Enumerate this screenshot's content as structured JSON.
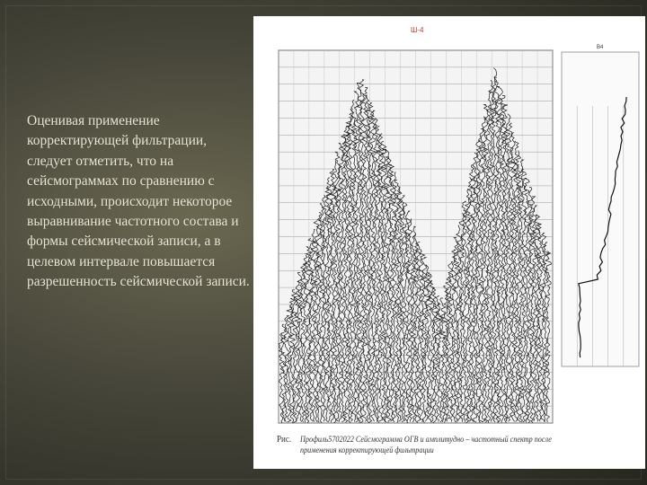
{
  "slide": {
    "body_text": "Оценивая применение корректирующей фильтрации, следует отметить, что на сейсмограммах по сравнению с исходными, происходит некоторое выравнивание частотного состава и формы сейсмической записи, а в целевом интервале повышается разрешенность сейсмической записи."
  },
  "figure": {
    "caption_label": "Рис.",
    "caption_text": "Профиль5702022 Сейсмограмма ОГВ и амплитудно – частотный спектр после применения корректирующей фильтрации",
    "top_label": "Ш-4",
    "side_title": "В4"
  }
}
